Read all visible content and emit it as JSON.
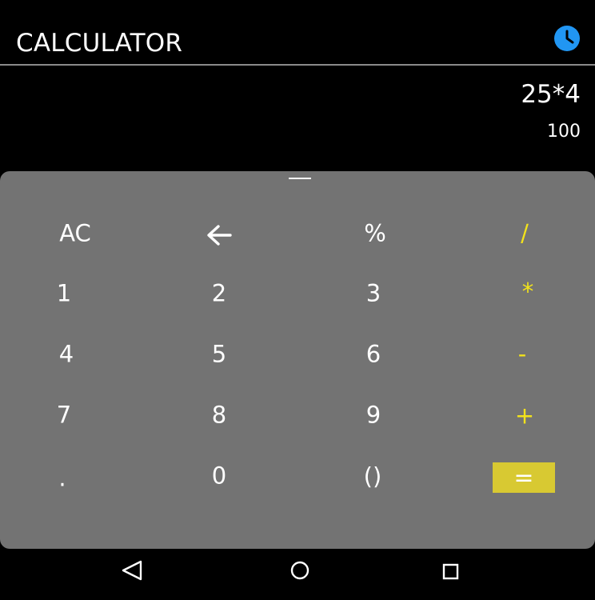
{
  "app": {
    "title": "CALCULATOR",
    "accent_color": "#2196F3",
    "operator_color": "#F2E21B",
    "equals_color": "#D8C932",
    "history_icon": "clock-icon"
  },
  "display": {
    "expression": "25*4",
    "result": "100"
  },
  "keypad": {
    "rows": [
      [
        "AC",
        "backspace",
        "%",
        "/"
      ],
      [
        "1",
        "2",
        "3",
        "*"
      ],
      [
        "4",
        "5",
        "6",
        "-"
      ],
      [
        "7",
        "8",
        "9",
        "+"
      ],
      [
        ".",
        "0",
        "()",
        "="
      ]
    ],
    "labels": {
      "ac": "AC",
      "percent": "%",
      "divide": "/",
      "one": "1",
      "two": "2",
      "three": "3",
      "multiply": "*",
      "four": "4",
      "five": "5",
      "six": "6",
      "minus": "-",
      "seven": "7",
      "eight": "8",
      "nine": "9",
      "plus": "+",
      "dot": ".",
      "zero": "0",
      "parens": "()",
      "equals": "="
    },
    "backspace_icon": "arrow-left-icon"
  },
  "navbar": {
    "back_icon": "back-triangle-icon",
    "home_icon": "home-circle-icon",
    "recents_icon": "recents-square-icon"
  }
}
